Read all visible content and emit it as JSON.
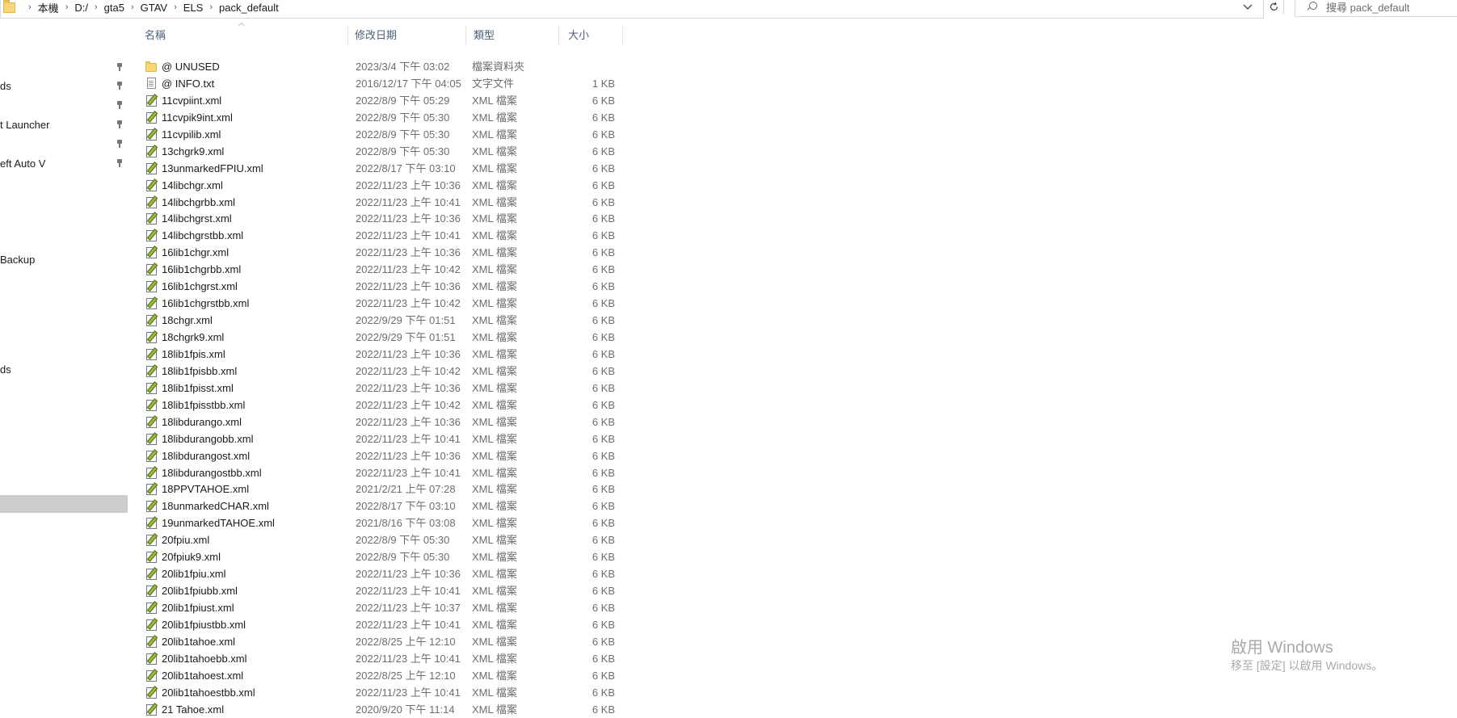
{
  "address_bar": {
    "breadcrumb": [
      "本機",
      "D:/",
      "gta5",
      "GTAV",
      "ELS",
      "pack_default"
    ],
    "dropdown_icon": "chevron-down-icon",
    "refresh_icon": "refresh-icon"
  },
  "search": {
    "placeholder": "搜尋 pack_default"
  },
  "nav_pane": {
    "items": [
      {
        "label": "",
        "pinned": true
      },
      {
        "label": "ds",
        "pinned": true
      },
      {
        "label": "",
        "pinned": true
      },
      {
        "label": "t Launcher",
        "pinned": true
      },
      {
        "label": "",
        "pinned": true
      },
      {
        "label": "eft Auto V",
        "pinned": true
      },
      {
        "label": "Backup",
        "pinned": false
      },
      {
        "label": "ds",
        "pinned": false
      }
    ]
  },
  "columns": {
    "name": "名稱",
    "date": "修改日期",
    "type": "類型",
    "size": "大小"
  },
  "files": [
    {
      "icon": "folder-icon",
      "name": "@ UNUSED",
      "date": "2023/3/4 下午 03:02",
      "type": "檔案資料夾",
      "size": ""
    },
    {
      "icon": "text-file-icon",
      "name": "@ INFO.txt",
      "date": "2016/12/17 下午 04:05",
      "type": "文字文件",
      "size": "1 KB"
    },
    {
      "icon": "xml-file-icon",
      "name": "11cvpiint.xml",
      "date": "2022/8/9 下午 05:29",
      "type": "XML 檔案",
      "size": "6 KB"
    },
    {
      "icon": "xml-file-icon",
      "name": "11cvpik9int.xml",
      "date": "2022/8/9 下午 05:30",
      "type": "XML 檔案",
      "size": "6 KB"
    },
    {
      "icon": "xml-file-icon",
      "name": "11cvpilib.xml",
      "date": "2022/8/9 下午 05:30",
      "type": "XML 檔案",
      "size": "6 KB"
    },
    {
      "icon": "xml-file-icon",
      "name": "13chgrk9.xml",
      "date": "2022/8/9 下午 05:30",
      "type": "XML 檔案",
      "size": "6 KB"
    },
    {
      "icon": "xml-file-icon",
      "name": "13unmarkedFPIU.xml",
      "date": "2022/8/17 下午 03:10",
      "type": "XML 檔案",
      "size": "6 KB"
    },
    {
      "icon": "xml-file-icon",
      "name": "14libchgr.xml",
      "date": "2022/11/23 上午 10:36",
      "type": "XML 檔案",
      "size": "6 KB"
    },
    {
      "icon": "xml-file-icon",
      "name": "14libchgrbb.xml",
      "date": "2022/11/23 上午 10:41",
      "type": "XML 檔案",
      "size": "6 KB"
    },
    {
      "icon": "xml-file-icon",
      "name": "14libchgrst.xml",
      "date": "2022/11/23 上午 10:36",
      "type": "XML 檔案",
      "size": "6 KB"
    },
    {
      "icon": "xml-file-icon",
      "name": "14libchgrstbb.xml",
      "date": "2022/11/23 上午 10:41",
      "type": "XML 檔案",
      "size": "6 KB"
    },
    {
      "icon": "xml-file-icon",
      "name": "16lib1chgr.xml",
      "date": "2022/11/23 上午 10:36",
      "type": "XML 檔案",
      "size": "6 KB"
    },
    {
      "icon": "xml-file-icon",
      "name": "16lib1chgrbb.xml",
      "date": "2022/11/23 上午 10:42",
      "type": "XML 檔案",
      "size": "6 KB"
    },
    {
      "icon": "xml-file-icon",
      "name": "16lib1chgrst.xml",
      "date": "2022/11/23 上午 10:36",
      "type": "XML 檔案",
      "size": "6 KB"
    },
    {
      "icon": "xml-file-icon",
      "name": "16lib1chgrstbb.xml",
      "date": "2022/11/23 上午 10:42",
      "type": "XML 檔案",
      "size": "6 KB"
    },
    {
      "icon": "xml-file-icon",
      "name": "18chgr.xml",
      "date": "2022/9/29 下午 01:51",
      "type": "XML 檔案",
      "size": "6 KB"
    },
    {
      "icon": "xml-file-icon",
      "name": "18chgrk9.xml",
      "date": "2022/9/29 下午 01:51",
      "type": "XML 檔案",
      "size": "6 KB"
    },
    {
      "icon": "xml-file-icon",
      "name": "18lib1fpis.xml",
      "date": "2022/11/23 上午 10:36",
      "type": "XML 檔案",
      "size": "6 KB"
    },
    {
      "icon": "xml-file-icon",
      "name": "18lib1fpisbb.xml",
      "date": "2022/11/23 上午 10:42",
      "type": "XML 檔案",
      "size": "6 KB"
    },
    {
      "icon": "xml-file-icon",
      "name": "18lib1fpisst.xml",
      "date": "2022/11/23 上午 10:36",
      "type": "XML 檔案",
      "size": "6 KB"
    },
    {
      "icon": "xml-file-icon",
      "name": "18lib1fpisstbb.xml",
      "date": "2022/11/23 上午 10:42",
      "type": "XML 檔案",
      "size": "6 KB"
    },
    {
      "icon": "xml-file-icon",
      "name": "18libdurango.xml",
      "date": "2022/11/23 上午 10:36",
      "type": "XML 檔案",
      "size": "6 KB"
    },
    {
      "icon": "xml-file-icon",
      "name": "18libdurangobb.xml",
      "date": "2022/11/23 上午 10:41",
      "type": "XML 檔案",
      "size": "6 KB"
    },
    {
      "icon": "xml-file-icon",
      "name": "18libdurangost.xml",
      "date": "2022/11/23 上午 10:36",
      "type": "XML 檔案",
      "size": "6 KB"
    },
    {
      "icon": "xml-file-icon",
      "name": "18libdurangostbb.xml",
      "date": "2022/11/23 上午 10:41",
      "type": "XML 檔案",
      "size": "6 KB"
    },
    {
      "icon": "xml-file-icon",
      "name": "18PPVTAHOE.xml",
      "date": "2021/2/21 上午 07:28",
      "type": "XML 檔案",
      "size": "6 KB"
    },
    {
      "icon": "xml-file-icon",
      "name": "18unmarkedCHAR.xml",
      "date": "2022/8/17 下午 03:10",
      "type": "XML 檔案",
      "size": "6 KB"
    },
    {
      "icon": "xml-file-icon",
      "name": "19unmarkedTAHOE.xml",
      "date": "2021/8/16 下午 03:08",
      "type": "XML 檔案",
      "size": "6 KB"
    },
    {
      "icon": "xml-file-icon",
      "name": "20fpiu.xml",
      "date": "2022/8/9 下午 05:30",
      "type": "XML 檔案",
      "size": "6 KB"
    },
    {
      "icon": "xml-file-icon",
      "name": "20fpiuk9.xml",
      "date": "2022/8/9 下午 05:30",
      "type": "XML 檔案",
      "size": "6 KB"
    },
    {
      "icon": "xml-file-icon",
      "name": "20lib1fpiu.xml",
      "date": "2022/11/23 上午 10:36",
      "type": "XML 檔案",
      "size": "6 KB"
    },
    {
      "icon": "xml-file-icon",
      "name": "20lib1fpiubb.xml",
      "date": "2022/11/23 上午 10:41",
      "type": "XML 檔案",
      "size": "6 KB"
    },
    {
      "icon": "xml-file-icon",
      "name": "20lib1fpiust.xml",
      "date": "2022/11/23 上午 10:37",
      "type": "XML 檔案",
      "size": "6 KB"
    },
    {
      "icon": "xml-file-icon",
      "name": "20lib1fpiustbb.xml",
      "date": "2022/11/23 上午 10:41",
      "type": "XML 檔案",
      "size": "6 KB"
    },
    {
      "icon": "xml-file-icon",
      "name": "20lib1tahoe.xml",
      "date": "2022/8/25 上午 12:10",
      "type": "XML 檔案",
      "size": "6 KB"
    },
    {
      "icon": "xml-file-icon",
      "name": "20lib1tahoebb.xml",
      "date": "2022/11/23 上午 10:41",
      "type": "XML 檔案",
      "size": "6 KB"
    },
    {
      "icon": "xml-file-icon",
      "name": "20lib1tahoest.xml",
      "date": "2022/8/25 上午 12:10",
      "type": "XML 檔案",
      "size": "6 KB"
    },
    {
      "icon": "xml-file-icon",
      "name": "20lib1tahoestbb.xml",
      "date": "2022/11/23 上午 10:41",
      "type": "XML 檔案",
      "size": "6 KB"
    },
    {
      "icon": "xml-file-icon",
      "name": "21 Tahoe.xml",
      "date": "2020/9/20 下午 11:14",
      "type": "XML 檔案",
      "size": "6 KB"
    }
  ],
  "watermark": {
    "title": "啟用 Windows",
    "subtitle": "移至 [設定] 以啟用 Windows。"
  }
}
